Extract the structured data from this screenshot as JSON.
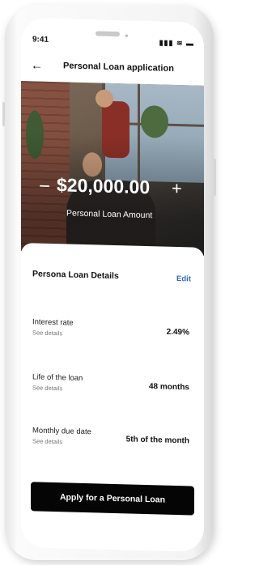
{
  "status_bar": {
    "time": "9:41",
    "signal_icons": "▮▮▮ ≋ ▬"
  },
  "navbar": {
    "back_icon": "arrow-left",
    "title": "Personal Loan application"
  },
  "hero": {
    "minus_symbol": "−",
    "amount": "$20,000.00",
    "plus_symbol": "+",
    "label": "Personal Loan Amount"
  },
  "details": {
    "title": "Persona Loan Details",
    "edit_label": "Edit",
    "rows": [
      {
        "label": "Interest rate",
        "link": "See details",
        "value": "2.49%"
      },
      {
        "label": "Life of the loan",
        "link": "See details",
        "value": "48 months"
      },
      {
        "label": "Monthly due date",
        "link": "See details",
        "value": "5th of the month"
      }
    ]
  },
  "cta": {
    "label": "Apply for a Personal Loan"
  },
  "colors": {
    "accent_link": "#2e67c9",
    "button_bg": "#050505"
  }
}
